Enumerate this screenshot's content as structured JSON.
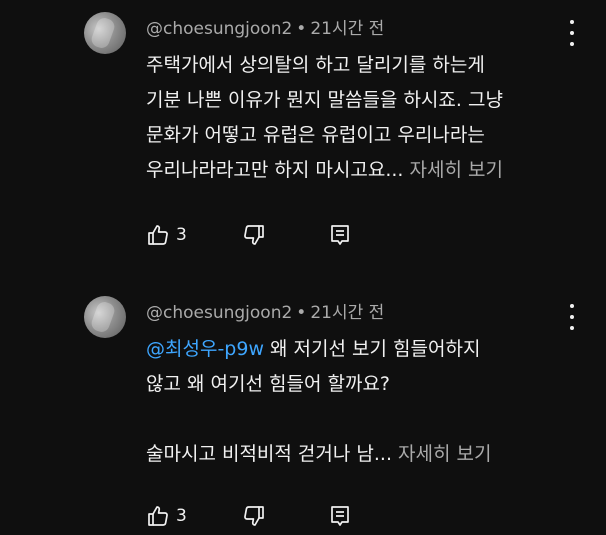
{
  "comments": [
    {
      "handle": "@choesungjoon2",
      "separator": "•",
      "time": "21시간 전",
      "lines": [
        "주택가에서 상의탈의 하고 달리기를 하는게",
        "기분 나쁜 이유가 뭔지 말씀들을 하시죠. 그냥",
        "문화가 어떻고 유럽은 유럽이고 우리나라는",
        "우리나라라고만 하지 마시고요..."
      ],
      "read_more": "자세히 보기",
      "like_count": "3"
    },
    {
      "handle": "@choesungjoon2",
      "separator": "•",
      "time": "21시간 전",
      "mention": "@최성우-p9w",
      "first_line_rest": " 왜 저기선 보기 힘들어하지",
      "lines": [
        "않고 왜 여기선 힘들어 할까요?",
        "",
        "술마시고 비적비적 걷거나 남..."
      ],
      "read_more": "자세히 보기",
      "like_count": "3"
    }
  ],
  "icons": {
    "like": "thumbs-up-icon",
    "dislike": "thumbs-down-icon",
    "reply": "reply-icon",
    "menu": "more-vert-icon"
  },
  "colors": {
    "background": "#0f0f0f",
    "text": "#f1f1f1",
    "secondary": "#aaaaaa",
    "mention": "#3ea6ff"
  }
}
